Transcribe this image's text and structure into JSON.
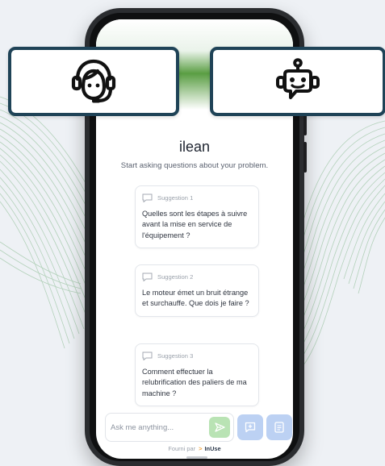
{
  "app": {
    "title": "ilean",
    "subtitle": "Start asking questions about your problem."
  },
  "suggestions": [
    {
      "label": "Suggestion 1",
      "text": "Quelles sont les étapes à suivre avant la mise en service de l'équipement ?"
    },
    {
      "label": "Suggestion 2",
      "text": "Le moteur émet un bruit étrange et surchauffe. Que dois je faire ?"
    },
    {
      "label": "Suggestion 3",
      "text": "Comment effectuer la relubrification des paliers de ma machine ?"
    }
  ],
  "chat_input": {
    "placeholder": "Ask me anything...",
    "value": ""
  },
  "footer": {
    "prefix": "Fourni par",
    "brand_mark": ">",
    "brand": "InUse"
  },
  "overlays": {
    "left_icon": "headset-agent-icon",
    "right_icon": "robot-chat-icon"
  },
  "colors": {
    "header_green": "#5a9e43",
    "send_button": "#b9e3b4",
    "action_buttons": "#bcd1f3",
    "overlay_border": "#1f4357",
    "brand_orange": "#f2a33a"
  }
}
